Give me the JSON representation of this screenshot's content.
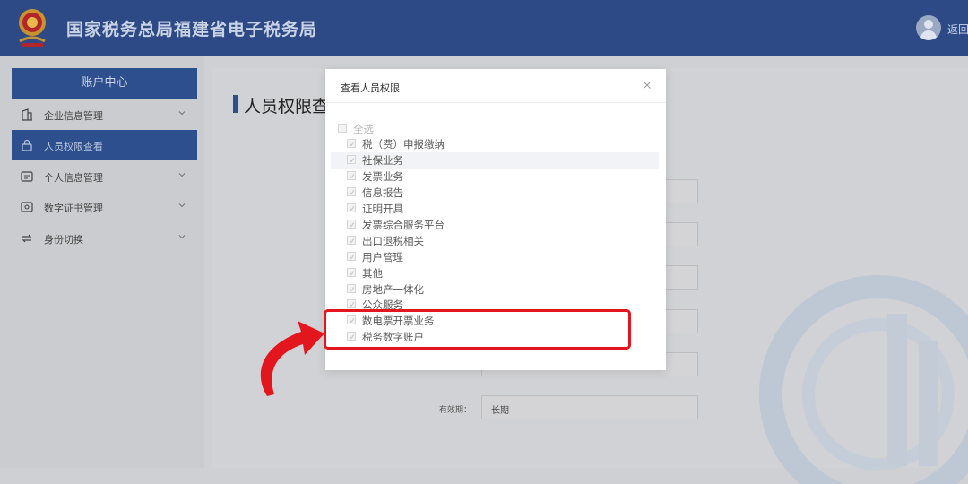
{
  "header": {
    "title": "国家税务总局福建省电子税务局",
    "return_label": "返回"
  },
  "sidebar": {
    "heading": "账户中心",
    "items": [
      {
        "label": "企业信息管理",
        "icon": "building-icon",
        "active": false,
        "expandable": true
      },
      {
        "label": "人员权限查看",
        "icon": "lock-icon",
        "active": true,
        "expandable": false
      },
      {
        "label": "个人信息管理",
        "icon": "id-card-icon",
        "active": false,
        "expandable": true
      },
      {
        "label": "数字证书管理",
        "icon": "certificate-icon",
        "active": false,
        "expandable": true
      },
      {
        "label": "身份切换",
        "icon": "switch-icon",
        "active": false,
        "expandable": true
      }
    ]
  },
  "main": {
    "title": "人员权限查",
    "validity_label": "有效期：",
    "validity_value": "长期"
  },
  "modal": {
    "title": "查看人员权限",
    "select_all": "全选",
    "permissions": [
      "税（费）申报缴纳",
      "社保业务",
      "发票业务",
      "信息报告",
      "证明开具",
      "发票综合服务平台",
      "出口退税相关",
      "用户管理",
      "其他",
      "房地产一体化",
      "公众服务",
      "数电票开票业务",
      "税务数字账户"
    ]
  },
  "colors": {
    "header_bg": "#2d4a86",
    "active_nav": "#2d4f8e",
    "highlight": "#e4161d"
  }
}
